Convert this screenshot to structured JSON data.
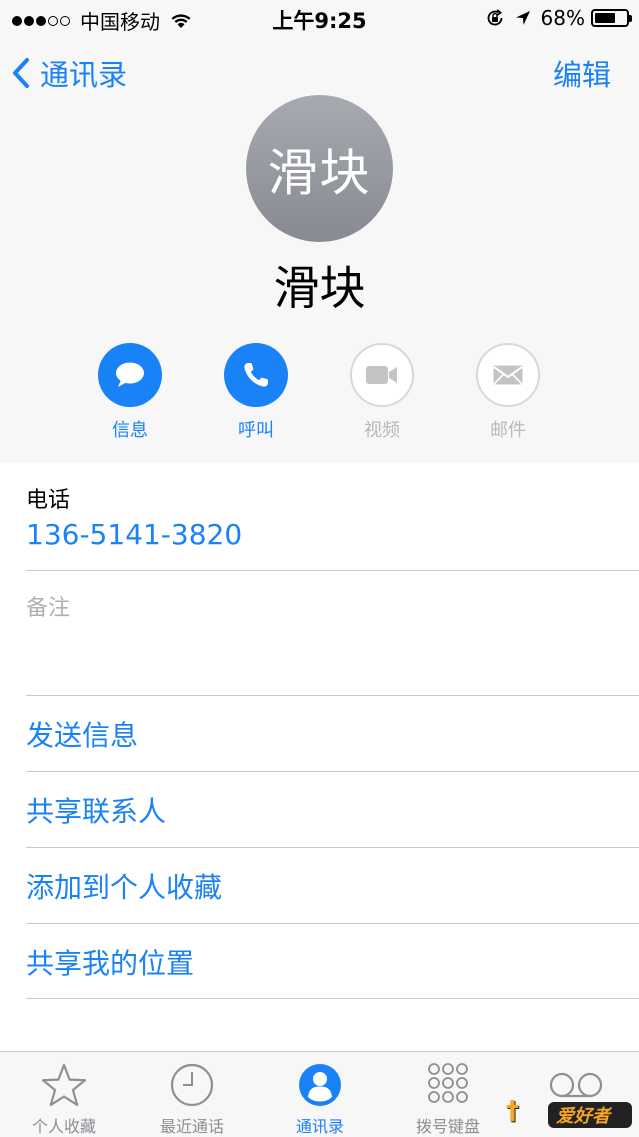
{
  "status_bar": {
    "carrier": "中国移动",
    "time": "上午9:25",
    "battery_percent": "68%",
    "battery_level": 0.68,
    "signal_bars": 3
  },
  "nav": {
    "back_label": "通讯录",
    "edit_label": "编辑"
  },
  "contact": {
    "avatar_text": "滑块",
    "name": "滑块"
  },
  "actions": [
    {
      "label": "信息",
      "icon": "message-icon",
      "enabled": true
    },
    {
      "label": "呼叫",
      "icon": "phone-icon",
      "enabled": true
    },
    {
      "label": "视频",
      "icon": "video-icon",
      "enabled": false
    },
    {
      "label": "邮件",
      "icon": "mail-icon",
      "enabled": false
    }
  ],
  "phone": {
    "label": "电话",
    "number": "136-5141-3820"
  },
  "notes": {
    "label": "备注"
  },
  "menu": [
    {
      "label": "发送信息"
    },
    {
      "label": "共享联系人"
    },
    {
      "label": "添加到个人收藏"
    },
    {
      "label": "共享我的位置"
    }
  ],
  "tabs": [
    {
      "label": "个人收藏",
      "icon": "star-icon",
      "active": false
    },
    {
      "label": "最近通话",
      "icon": "clock-icon",
      "active": false
    },
    {
      "label": "通讯录",
      "icon": "contacts-icon",
      "active": true
    },
    {
      "label": "拨号键盘",
      "icon": "keypad-icon",
      "active": false
    },
    {
      "label": "语音留言",
      "icon": "voicemail-icon",
      "active": false
    }
  ],
  "watermark": {
    "text": "爱好者"
  },
  "colors": {
    "accent": "#1a82f7",
    "disabled": "#b9b9bc",
    "header_bg": "#f7f7f8"
  }
}
